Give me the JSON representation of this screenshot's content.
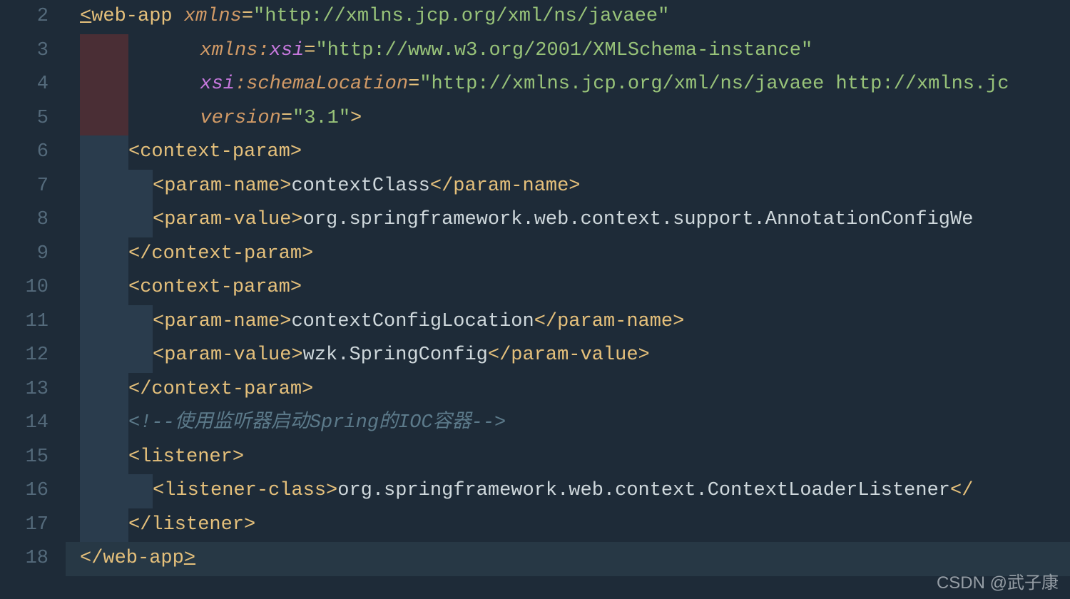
{
  "gutter": {
    "lines": [
      "2",
      "3",
      "4",
      "5",
      "6",
      "7",
      "8",
      "9",
      "10",
      "11",
      "12",
      "13",
      "14",
      "15",
      "16",
      "17",
      "18"
    ],
    "bulb_at": "17"
  },
  "code": {
    "l2": {
      "tag_open": "<",
      "tag_name": "web-app",
      "attr": "xmlns",
      "eq": "=",
      "val": "\"http://xmlns.jcp.org/xml/ns/javaee\""
    },
    "l3": {
      "attr_prefix": "xmlns:",
      "attr_local": "xsi",
      "eq": "=",
      "val": "\"http://www.w3.org/2001/XMLSchema-instance\""
    },
    "l4": {
      "attr_prefix": "xsi",
      "colon": ":",
      "attr_local": "schemaLocation",
      "eq": "=",
      "val": "\"http://xmlns.jcp.org/xml/ns/javaee http://xmlns.jc"
    },
    "l5": {
      "attr": "version",
      "eq": "=",
      "val": "\"3.1\"",
      "close": ">"
    },
    "l6": {
      "tag": "<context-param>"
    },
    "l7": {
      "open": "<param-name>",
      "text": "contextClass",
      "close": "</param-name>"
    },
    "l8": {
      "open": "<param-value>",
      "text": "org.springframework.web.context.support.AnnotationConfigWe"
    },
    "l9": {
      "tag": "</context-param>"
    },
    "l10": {
      "tag": "<context-param>"
    },
    "l11": {
      "open": "<param-name>",
      "text": "contextConfigLocation",
      "close": "</param-name>"
    },
    "l12": {
      "open": "<param-value>",
      "text": "wzk.SpringConfig",
      "close": "</param-value>"
    },
    "l13": {
      "tag": "</context-param>"
    },
    "l14": {
      "comment": "<!--使用监听器启动Spring的IOC容器-->"
    },
    "l15": {
      "tag": "<listener>"
    },
    "l16": {
      "open": "<listener-class>",
      "text": "org.springframework.web.context.ContextLoaderListener",
      "close": "</"
    },
    "l17": {
      "tag": "</listener>"
    },
    "l18": {
      "tag_open": "</",
      "tag_name": "web-app",
      "tag_close": ">"
    }
  },
  "watermark": "CSDN @武子康"
}
